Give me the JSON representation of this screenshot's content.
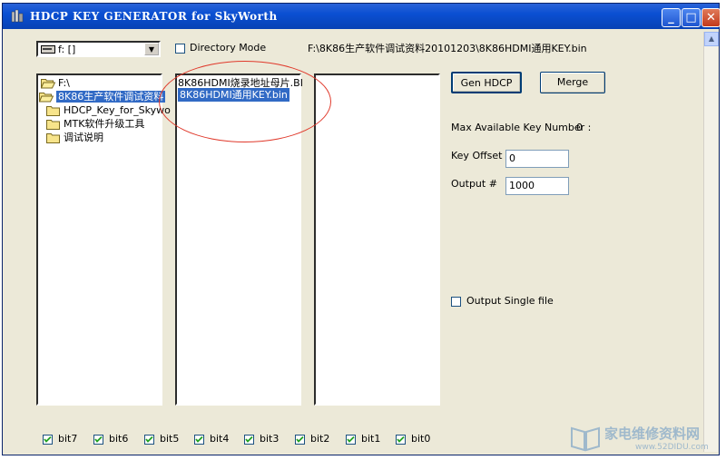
{
  "window": {
    "title": "HDCP KEY GENERATOR for SkyWorth",
    "controls": [
      "minimize-icon",
      "maximize-icon",
      "close-icon"
    ]
  },
  "drive_select": {
    "value": "f: []"
  },
  "directory_mode": {
    "label": "Directory Mode",
    "checked": false
  },
  "current_path": "F:\\8K86生产软件调试资料20101203\\8K86HDMI通用KEY.bin",
  "folder_list": {
    "items": [
      {
        "label": "F:\\",
        "icon": "open-folder-icon",
        "selected": false
      },
      {
        "label": "8K86生产软件调试资料",
        "icon": "open-folder-icon",
        "selected": true
      },
      {
        "label": "HDCP_Key_for_Skywo",
        "icon": "folder-icon",
        "selected": false
      },
      {
        "label": "MTK软件升级工具",
        "icon": "folder-icon",
        "selected": false
      },
      {
        "label": "调试说明",
        "icon": "folder-icon",
        "selected": false
      }
    ]
  },
  "file_list": {
    "items": [
      {
        "label": "8K86HDMI烧录地址母片.BI",
        "selected": false
      },
      {
        "label": "8K86HDMI通用KEY.bin",
        "selected": true
      }
    ]
  },
  "buttons": {
    "gen_hdcp": "Gen HDCP",
    "merge": "Merge"
  },
  "info": {
    "max_key_label": "Max Available Key Number :",
    "max_key_value": "0",
    "key_offset_label": "Key Offset",
    "key_offset_value": "0",
    "output_label": "Output  #",
    "output_value": "1000"
  },
  "output_single": {
    "label": "Output Single file",
    "checked": false
  },
  "bits": [
    {
      "label": "bit7",
      "checked": true
    },
    {
      "label": "bit6",
      "checked": true
    },
    {
      "label": "bit5",
      "checked": true
    },
    {
      "label": "bit4",
      "checked": true
    },
    {
      "label": "bit3",
      "checked": true
    },
    {
      "label": "bit2",
      "checked": true
    },
    {
      "label": "bit1",
      "checked": true
    },
    {
      "label": "bit0",
      "checked": true
    }
  ],
  "watermark": {
    "text": "家电维修资料网",
    "url": "www.52DIDU.com"
  },
  "colors": {
    "selection": "#316ac5",
    "annotation": "#e0392b",
    "title_bar": "#0a4fd2"
  }
}
